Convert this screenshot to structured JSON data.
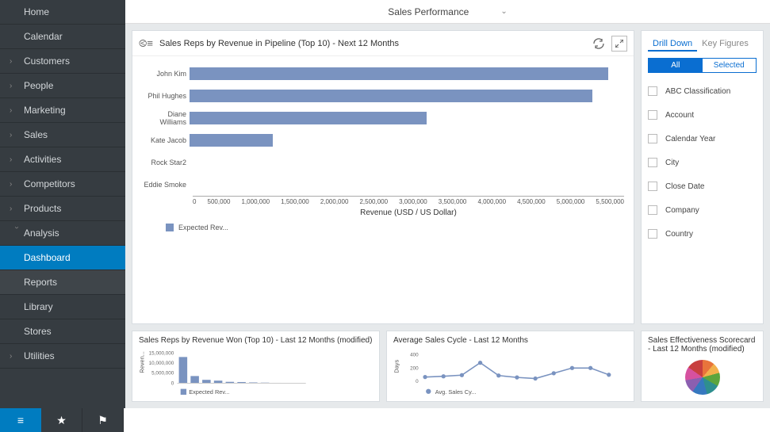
{
  "header": {
    "title": "Sales Performance"
  },
  "sidebar": {
    "items": [
      {
        "label": "Home",
        "chev": false
      },
      {
        "label": "Calendar",
        "chev": false
      },
      {
        "label": "Customers",
        "chev": true
      },
      {
        "label": "People",
        "chev": true
      },
      {
        "label": "Marketing",
        "chev": true
      },
      {
        "label": "Sales",
        "chev": true
      },
      {
        "label": "Activities",
        "chev": true
      },
      {
        "label": "Competitors",
        "chev": true
      },
      {
        "label": "Products",
        "chev": true
      },
      {
        "label": "Analysis",
        "chev": true,
        "expanded": true
      },
      {
        "label": "Dashboard",
        "sub": true,
        "active": true
      },
      {
        "label": "Reports",
        "sub": true
      },
      {
        "label": "Library",
        "sub": true
      },
      {
        "label": "Stores",
        "sub": true
      },
      {
        "label": "Utilities",
        "chev": true
      }
    ]
  },
  "chart_data": {
    "type": "bar",
    "title": "Sales Reps by Revenue in Pipeline (Top 10) - Next 12 Months",
    "categories": [
      "John Kim",
      "Phil Hughes",
      "Diane Williams",
      "Kate Jacob",
      "Rock Star2",
      "Eddie Smoke"
    ],
    "values": [
      5300000,
      5100000,
      3000000,
      1050000,
      0,
      0
    ],
    "xlabel": "Revenue (USD / US Dollar)",
    "xlim": [
      0,
      5500000
    ],
    "ticks": [
      "0",
      "500,000",
      "1,000,000",
      "1,500,000",
      "2,000,000",
      "2,500,000",
      "3,000,000",
      "3,500,000",
      "4,000,000",
      "4,500,000",
      "5,000,000",
      "5,500,000"
    ],
    "legend": "Expected Rev..."
  },
  "small_charts": [
    {
      "title": "Sales Reps by Revenue Won (Top 10) - Last 12 Months (modified)",
      "ylabel": "Reven...",
      "legend": "Expected Rev...",
      "ticks": [
        "15,000,000",
        "10,000,000",
        "5,000,000",
        "0"
      ],
      "values": [
        13000000,
        3500000,
        1600000,
        1200000,
        600000,
        500000,
        300000,
        200000,
        100000,
        50000
      ]
    },
    {
      "title": "Average Sales Cycle - Last 12 Months",
      "ylabel": "Days",
      "legend": "Avg. Sales Cy...",
      "ticks": [
        "400",
        "200",
        "0"
      ],
      "points": [
        80,
        90,
        105,
        270,
        100,
        75,
        60,
        130,
        200,
        200,
        110
      ]
    },
    {
      "title": "Sales Effectiveness Scorecard - Last 12 Months (modified)"
    }
  ],
  "drill": {
    "tabs": [
      "Drill Down",
      "Key Figures"
    ],
    "seg": [
      "All",
      "Selected"
    ],
    "filters": [
      "ABC Classification",
      "Account",
      "Calendar Year",
      "City",
      "Close Date",
      "Company",
      "Country"
    ]
  }
}
